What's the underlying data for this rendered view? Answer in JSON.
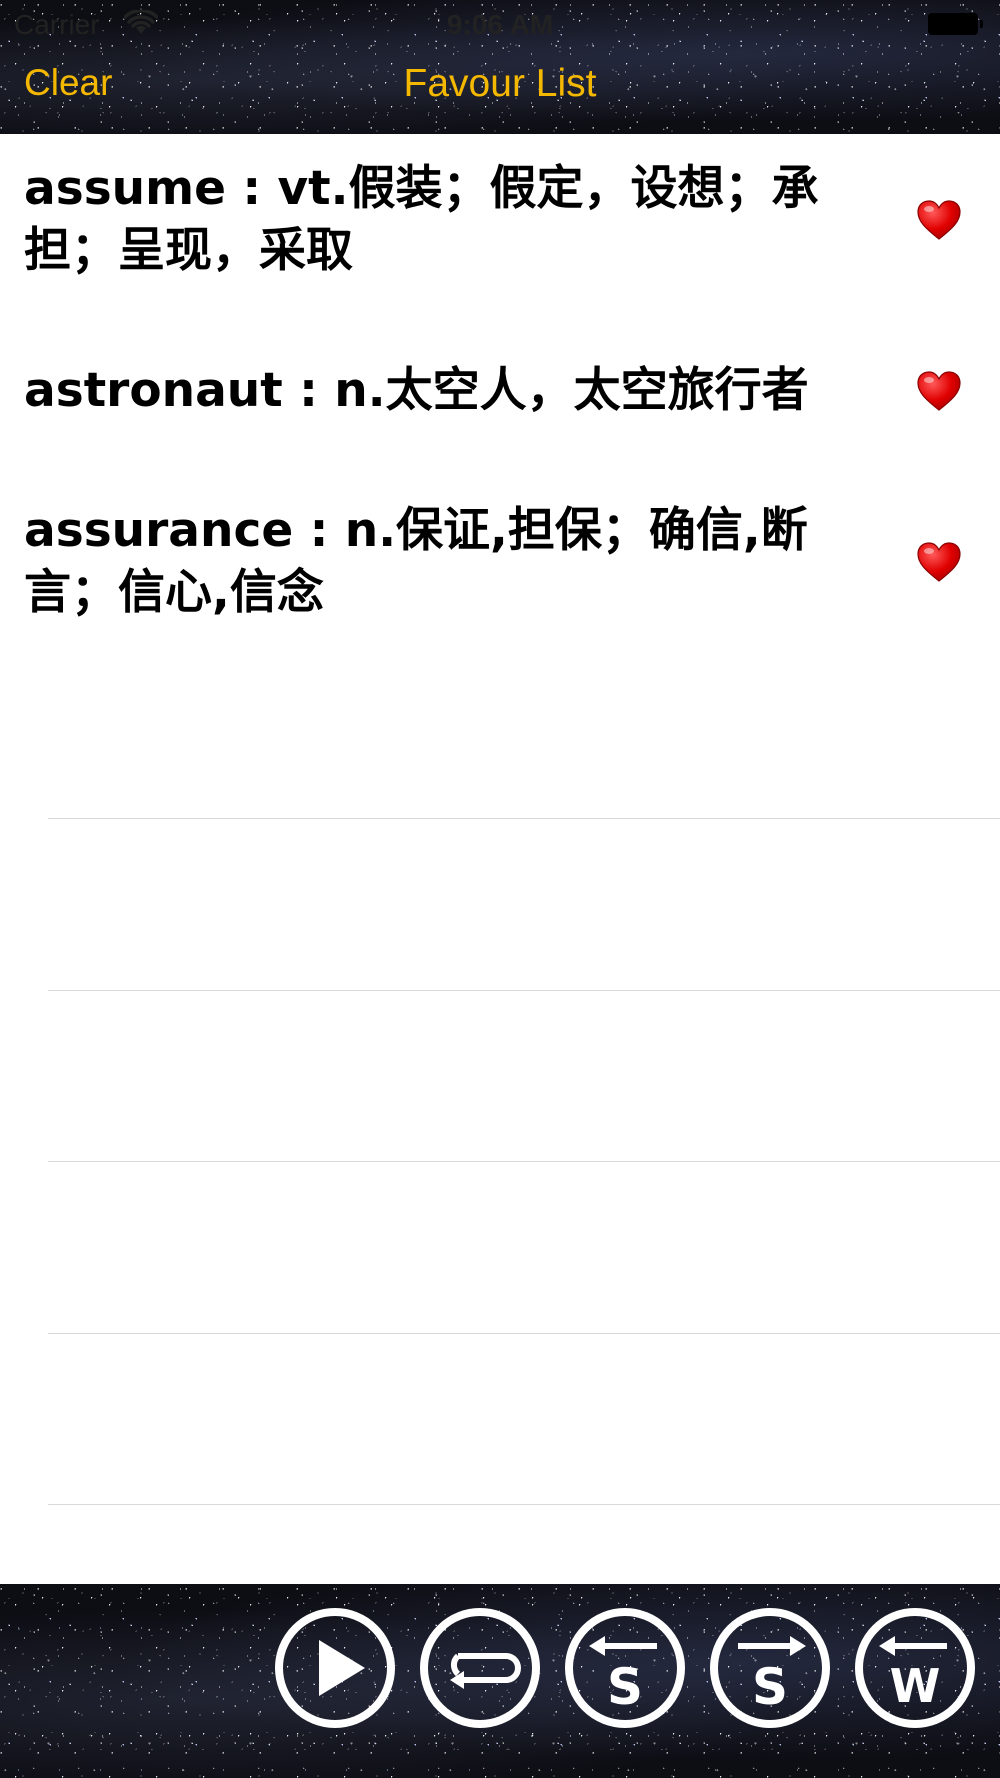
{
  "status_bar": {
    "carrier": "Carrier",
    "time": "9:06 AM",
    "wifi_icon": "wifi-icon",
    "battery_icon": "battery-icon"
  },
  "nav": {
    "clear_label": "Clear",
    "title": "Favour List",
    "accent_color": "#f5b800"
  },
  "favorites": [
    {
      "text": "assume : vt.假装；假定，设想；承担；呈现，采取",
      "icon": "heart-icon"
    },
    {
      "text": "astronaut : n.太空人，太空旅行者",
      "icon": "heart-icon"
    },
    {
      "text": "assurance : n.保证,担保；确信,断言；信心,信念",
      "icon": "heart-icon"
    }
  ],
  "toolbar": {
    "buttons": [
      {
        "name": "play",
        "icon": "play-icon",
        "letter": ""
      },
      {
        "name": "repeat",
        "icon": "repeat-icon",
        "letter": ""
      },
      {
        "name": "previous-sentence",
        "icon": "arrow-left-s-icon",
        "letter": "S"
      },
      {
        "name": "next-sentence",
        "icon": "arrow-right-s-icon",
        "letter": "S"
      },
      {
        "name": "previous-word",
        "icon": "arrow-left-w-icon",
        "letter": "W"
      }
    ]
  }
}
